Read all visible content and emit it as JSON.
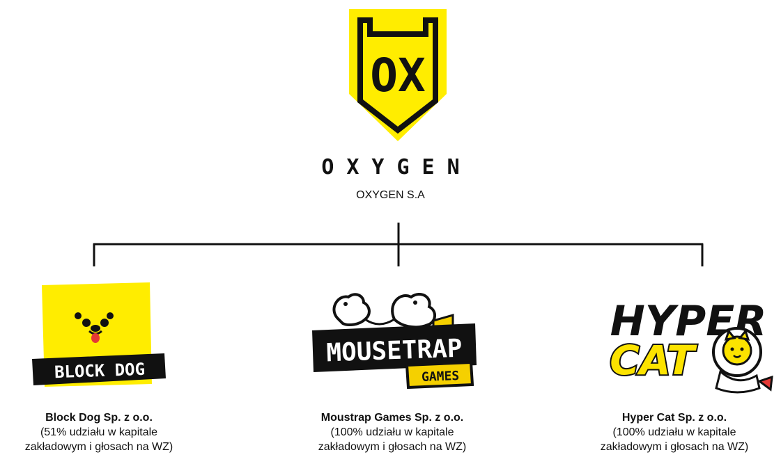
{
  "parent": {
    "logo_letters": "OX",
    "brand_word": "OXYGEN",
    "name": "OXYGEN S.A"
  },
  "subsidiaries": [
    {
      "logo_text": "BLOCK DOG",
      "name": "Block Dog Sp. z o.o.",
      "share_line1": "(51% udziału w kapitale",
      "share_line2": "zakładowym i głosach na WZ)"
    },
    {
      "logo_text": "MOUSETRAP",
      "logo_subtext": "GAMES",
      "name": "Moustrap Games Sp. z o.o.",
      "share_line1": "(100% udziału w kapitale",
      "share_line2": "zakładowym i głosach na WZ)"
    },
    {
      "logo_text": "HYPER",
      "logo_subtext": "CAT",
      "name": "Hyper Cat Sp. z o.o.",
      "share_line1": "(100% udziału w kapitale",
      "share_line2": "zakładowym i głosach na WZ)"
    }
  ],
  "colors": {
    "brand_yellow": "#FFED00",
    "ink": "#111111",
    "mouse_yellow": "#F5D000",
    "hypercat_yellow": "#FCE300"
  }
}
